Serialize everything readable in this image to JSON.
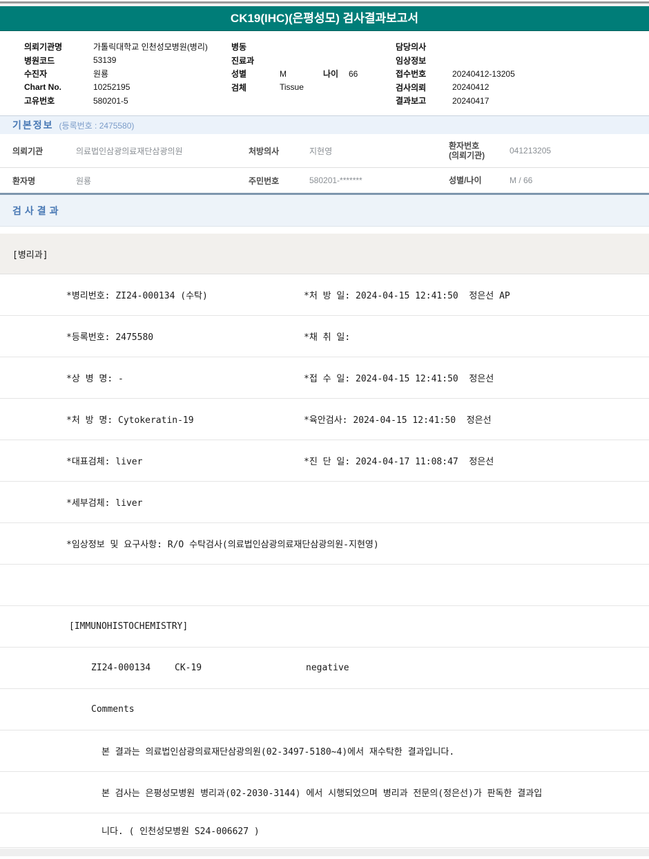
{
  "colors": {
    "teal": "#007d78",
    "section_blue": "#4878b4",
    "divider_blue": "#7e96ae"
  },
  "title": "CK19(IHC)(은평성모) 검사결과보고서",
  "header_meta": {
    "col1": {
      "r1_label": "의뢰기관명",
      "r1_value": "가톨릭대학교 인천성모병원(병리)",
      "r2_label": "병원코드",
      "r2_value": "53139",
      "r3_label": "수진자",
      "r3_value": "원룡",
      "r4_label": "Chart No.",
      "r4_value": "10252195",
      "r5_label": "고유번호",
      "r5_value": "580201-5"
    },
    "col2": {
      "r1_label": "병동",
      "r2_label": "진료과",
      "r3_label": "성별",
      "r3_value": "M",
      "r3_label2": "나이",
      "r3_value2": "66",
      "r4_label": "검체",
      "r4_value": "Tissue"
    },
    "col3": {
      "r1_label": "담당의사",
      "r2_label": "임상정보",
      "r3_label": "접수번호",
      "r3_value": "20240412-13205",
      "r4_label": "검사의뢰",
      "r4_value": "20240412",
      "r5_label": "결과보고",
      "r5_value": "20240417"
    }
  },
  "basic_info": {
    "title": "기본정보",
    "reg_note": "(등록번호 : 2475580)",
    "row1": {
      "c1_label": "의뢰기관",
      "c1_value": "의료법인삼광의료재단삼광의원",
      "c2_label": "처방의사",
      "c2_value": "지현영",
      "c3_label_line1": "환자번호",
      "c3_label_line2": "(의뢰기관)",
      "c3_value": "041213205"
    },
    "row2": {
      "c1_label": "환자명",
      "c1_value": "원룡",
      "c2_label": "주민번호",
      "c2_value": "580201-*******",
      "c3_label": "성별/나이",
      "c3_value": "M / 66"
    }
  },
  "results": {
    "section_title": "검사결과",
    "dept": "[병리과]",
    "detail_rows": [
      {
        "left": "*병리번호: ZI24-000134 (수탁)",
        "right": "*처 방 일: 2024-04-15 12:41:50  정은선 AP"
      },
      {
        "left": "*등록번호: 2475580",
        "right": "*채 취 일:"
      },
      {
        "left": "*상 병 명: -",
        "right": "*접 수 일: 2024-04-15 12:41:50  정은선"
      },
      {
        "left": "*처 방 명: Cytokeratin-19",
        "right": "*육안검사: 2024-04-15 12:41:50  정은선"
      },
      {
        "left": "*대표검체: liver",
        "right": "*진 단 일: 2024-04-17 11:08:47  정은선"
      },
      {
        "left": "*세부검체: liver",
        "right": ""
      },
      {
        "left": "*임상정보 및 요구사항: R/O 수탁검사(의료법인삼광의료재단삼광의원-지현영)",
        "right": ""
      },
      {
        "left": "",
        "right": ""
      }
    ],
    "ihc_header": "[IMMUNOHISTOCHEMISTRY]",
    "ihc_row": {
      "pathology_no": "ZI24-000134",
      "test_name": "CK-19",
      "result": "negative"
    },
    "comments_label": "Comments",
    "comment_lines": [
      "본 결과는 의료법인삼광의료재단삼광의원(02-3497-5180~4)에서 재수탁한 결과입니다.",
      "본 검사는 은평성모병원 병리과(02-2030-3144) 에서 시행되었으며 병리과 전문의(정은선)가 판독한 결과입",
      "니다. ( 인천성모병원 S24-006627 )"
    ]
  }
}
